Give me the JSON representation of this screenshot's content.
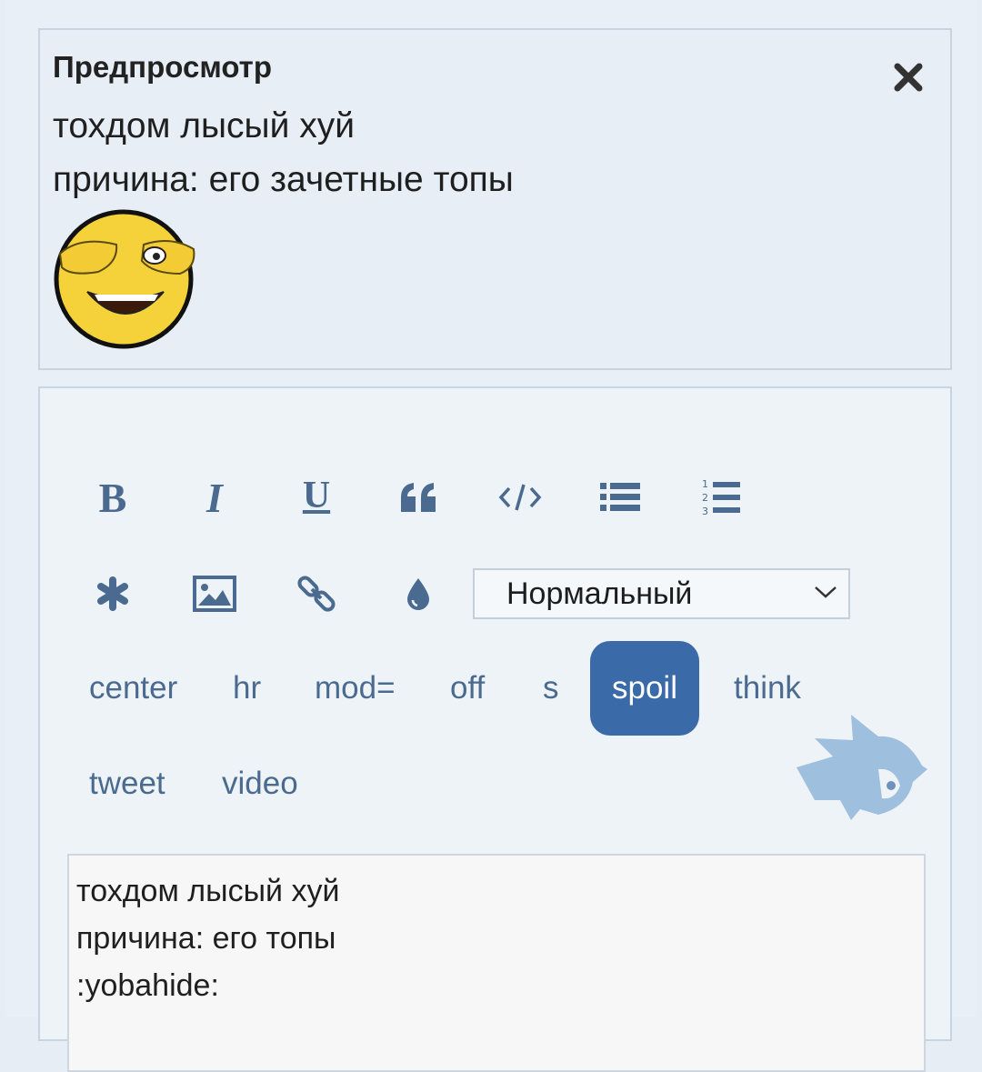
{
  "preview": {
    "title": "Предпросмотр",
    "lines": [
      "тохдом лысый хуй",
      "причина: его зачетные топы"
    ],
    "emoji_icon": "yobahide-smiley",
    "close_icon": "close-icon"
  },
  "toolbar": {
    "bold": "B",
    "italic": "I",
    "underline": "U",
    "icons": [
      "quote-icon",
      "code-icon",
      "list-icon",
      "ordered-list-icon",
      "spoiler-asterisk-icon",
      "image-icon",
      "link-icon",
      "color-drop-icon"
    ],
    "size_select": {
      "value": "Нормальный"
    }
  },
  "tags": [
    {
      "label": "center"
    },
    {
      "label": "hr"
    },
    {
      "label": "mod="
    },
    {
      "label": "off"
    },
    {
      "label": "s"
    },
    {
      "label": "spoil",
      "active": true
    },
    {
      "label": "think"
    },
    {
      "label": "tweet"
    },
    {
      "label": "video"
    }
  ],
  "textarea": {
    "lines": [
      "тохдом лысый хуй",
      "причина: его топы",
      ":yobahide:"
    ]
  },
  "colors": {
    "accent": "#3a6aa8",
    "icon": "#4a6a8f",
    "border": "#c8d4e2"
  }
}
